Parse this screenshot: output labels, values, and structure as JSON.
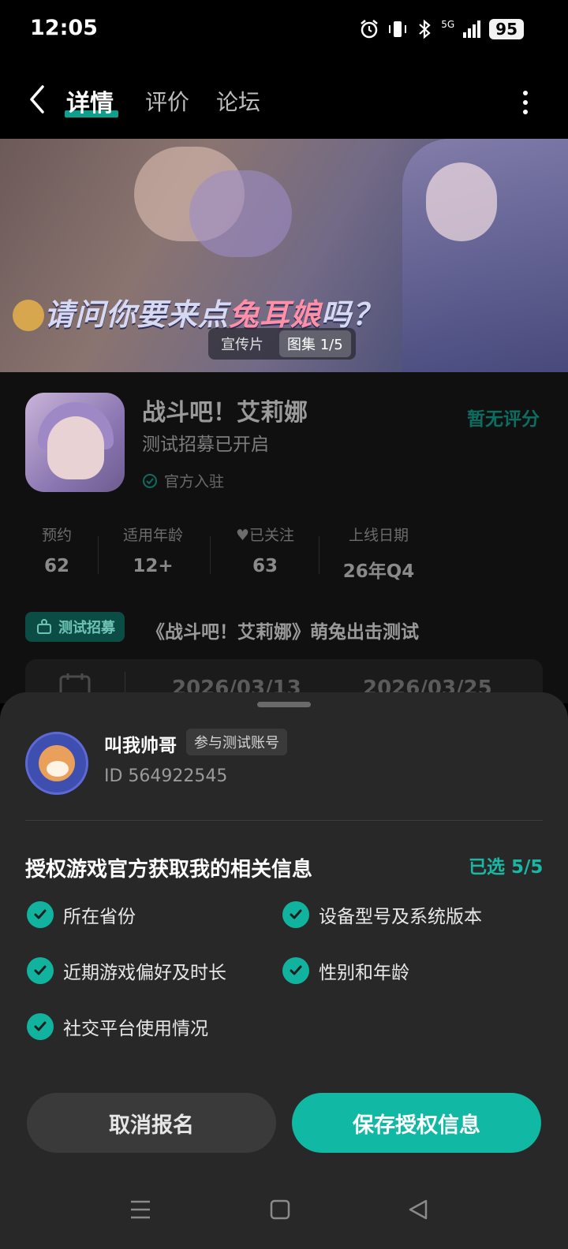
{
  "status_bar": {
    "time": "12:05",
    "battery": "95",
    "signal_label": "5G"
  },
  "nav": {
    "tabs": [
      "详情",
      "评价",
      "论坛"
    ],
    "active_tab": 0
  },
  "banner": {
    "title_part1": "请问你要来点",
    "title_part2": "兔耳娘",
    "title_part3": "吗？",
    "chip_video": "宣传片",
    "chip_gallery": "图集 1/5"
  },
  "app": {
    "name": "战斗吧！艾莉娜",
    "subtitle": "测试招募已开启",
    "official": "官方入驻",
    "rating": "暂无评分"
  },
  "stats": [
    {
      "label": "预约",
      "value": "62"
    },
    {
      "label": "适用年龄",
      "value": "12+"
    },
    {
      "label": "已关注",
      "value": "63"
    },
    {
      "label": "上线日期",
      "value": "26年Q4"
    }
  ],
  "recruit": {
    "tag": "测试招募",
    "title": "《战斗吧！艾莉娜》萌兔出击测试",
    "date_start": "2026/03/13",
    "date_end": "2026/03/25"
  },
  "sheet": {
    "user_name": "叫我帅哥",
    "user_badge": "参与测试账号",
    "user_id": "ID 564922545",
    "auth_title": "授权游戏官方获取我的相关信息",
    "auth_count": "已选 5/5",
    "permissions": [
      "所在省份",
      "设备型号及系统版本",
      "近期游戏偏好及时长",
      "性别和年龄",
      "社交平台使用情况"
    ],
    "cancel_label": "取消报名",
    "save_label": "保存授权信息"
  },
  "colors": {
    "accent": "#11b8a4",
    "sheet_bg": "#282828"
  },
  "icons": [
    "alarm-icon",
    "vibrate-icon",
    "bluetooth-icon",
    "signal-icon",
    "back-icon",
    "more-icon",
    "check-icon",
    "calendar-icon",
    "menu-icon",
    "home-icon",
    "back-nav-icon"
  ]
}
